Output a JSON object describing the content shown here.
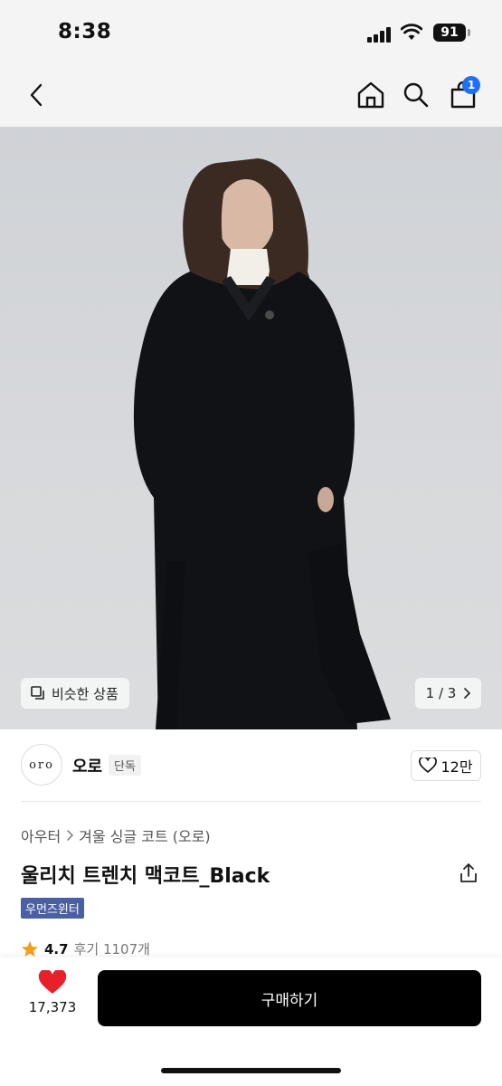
{
  "status_bar": {
    "time": "8:38",
    "battery": "91"
  },
  "nav": {
    "cart_count": "1"
  },
  "image": {
    "similar_label": "비슷한 상품",
    "pager": "1 / 3"
  },
  "brand": {
    "logo_text": "oro",
    "name": "오로",
    "tag": "단독",
    "like_count": "12만"
  },
  "breadcrumb": {
    "level1": "아우터",
    "level2": "겨울 싱글 코트 (오로)"
  },
  "product": {
    "title": "울리치 트렌치 맥코트_Black",
    "category_badge": "우먼즈윈터",
    "rating": "4.7",
    "reviews": "후기 1107개"
  },
  "bottom": {
    "wish_count": "17,373",
    "buy_label": "구매하기"
  },
  "colors": {
    "accent_blue": "#1f6ff5",
    "badge_purple": "#4b5fa4",
    "heart_red": "#e8202a",
    "star_orange": "#f0a020"
  }
}
